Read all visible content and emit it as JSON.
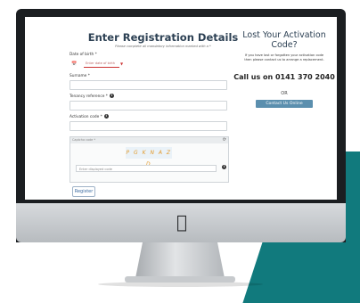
{
  "form": {
    "title": "Enter Registration Details",
    "subtitle": "Please complete all mandatory information marked with a *",
    "dob_label": "Date of birth *",
    "dob_placeholder": "Enter date of birth",
    "surname_label": "Surname *",
    "tenancy_label": "Tenancy reference *",
    "activation_label": "Activation code *",
    "captcha_header": "Captcha code *",
    "captcha_text": "P G K N A Z D",
    "captcha_input_placeholder": "Enter displayed code",
    "register_label": "Register"
  },
  "sidebar": {
    "title": "Lost Your Activation Code?",
    "text": "If you have lost or forgotten your activation code then please contact us to arrange a replacement.",
    "phone": "Call us on 0141 370 2040",
    "or": "OR",
    "contact_label": "Contact Us Online"
  },
  "colors": {
    "teal": "#117a7d",
    "heading": "#2d4154",
    "contact_button": "#5b8fae"
  }
}
